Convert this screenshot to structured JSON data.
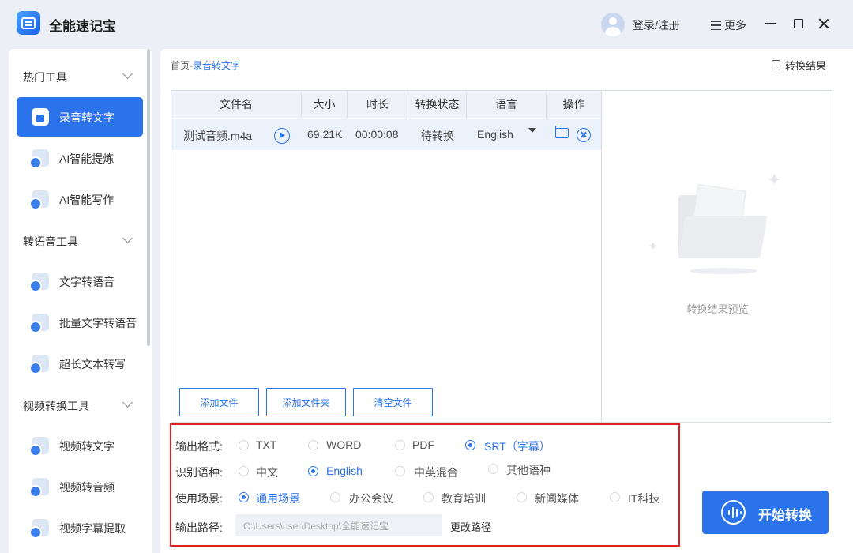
{
  "app": {
    "title": "全能速记宝"
  },
  "header": {
    "login": "登录/注册",
    "more": "更多"
  },
  "sidebar": {
    "sections": [
      {
        "title": "热门工具",
        "items": [
          "录音转文字",
          "AI智能提炼",
          "AI智能写作"
        ]
      },
      {
        "title": "转语音工具",
        "items": [
          "文字转语音",
          "批量文字转语音",
          "超长文本转写"
        ]
      },
      {
        "title": "视频转换工具",
        "items": [
          "视频转文字",
          "视频转音频",
          "视频字幕提取"
        ]
      }
    ],
    "active": "录音转文字"
  },
  "breadcrumb": {
    "home": "首页",
    "sep": "-",
    "current": "录音转文字"
  },
  "result_link": "转换结果",
  "table": {
    "headers": [
      "文件名",
      "大小",
      "时长",
      "转换状态",
      "语言",
      "操作"
    ],
    "rows": [
      {
        "name": "测试音频.m4a",
        "size": "69.21K",
        "duration": "00:00:08",
        "status": "待转换",
        "language": "English"
      }
    ]
  },
  "file_buttons": {
    "add_file": "添加文件",
    "add_folder": "添加文件夹",
    "clear": "清空文件"
  },
  "preview": {
    "text": "转换结果预览"
  },
  "options": {
    "format": {
      "label": "输出格式:",
      "choices": [
        "TXT",
        "WORD",
        "PDF",
        "SRT（字幕）"
      ],
      "selected": "SRT（字幕）"
    },
    "language": {
      "label": "识别语种:",
      "choices": [
        "中文",
        "English",
        "中英混合",
        "其他语种"
      ],
      "selected": "English"
    },
    "scene": {
      "label": "使用场景:",
      "choices": [
        "通用场景",
        "办公会议",
        "教育培训",
        "新闻媒体",
        "IT科技"
      ],
      "selected": "通用场景"
    },
    "path": {
      "label": "输出路径:",
      "value": "C:\\Users\\user\\Desktop\\全能速记宝",
      "change": "更改路径"
    }
  },
  "start_button": "开始转换",
  "colors": {
    "accent": "#2b73ea",
    "highlight_border": "#e02020",
    "background": "#ecf0f6"
  }
}
